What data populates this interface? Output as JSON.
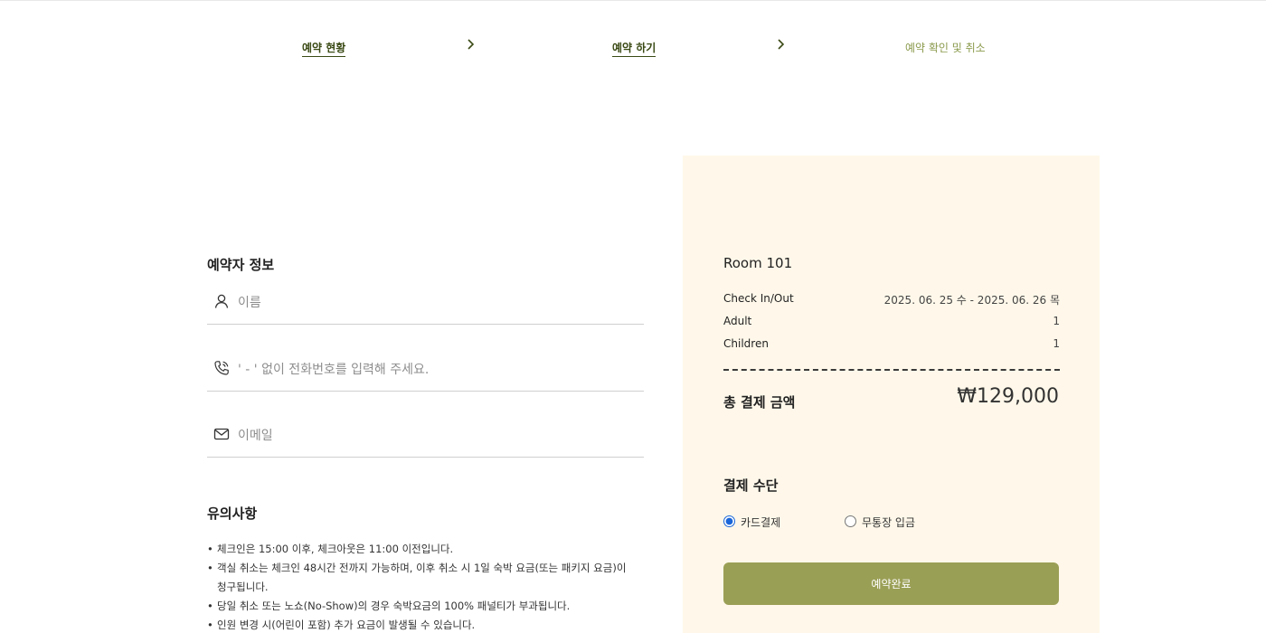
{
  "steps": [
    {
      "label": "예약 현황",
      "state": "done"
    },
    {
      "label": "예약 하기",
      "state": "current"
    },
    {
      "label": "예약 확인 및 취소",
      "state": "pending"
    }
  ],
  "guest": {
    "title": "예약자 정보",
    "name_placeholder": "이름",
    "phone_placeholder": "' - ' 없이 전화번호를 입력해 주세요.",
    "email_placeholder": "이메일"
  },
  "notes": {
    "title": "유의사항",
    "items": [
      "체크인은 15:00 이후, 체크아웃은 11:00 이전입니다.",
      "객실 취소는 체크인 48시간 전까지 가능하며, 이후 취소 시 1일 숙박 요금(또는 패키지 요금)이 청구됩니다.",
      "당일 취소 또는 노쇼(No-Show)의 경우 숙박요금의 100% 패널티가 부과됩니다.",
      "인원 변경 시(어린이 포함) 추가 요금이 발생될 수 있습니다."
    ]
  },
  "summary": {
    "room": "Room 101",
    "rows": [
      {
        "key": "Check In/Out",
        "value": "2025. 06. 25 수 - 2025. 06. 26 목"
      },
      {
        "key": "Adult",
        "value": "1"
      },
      {
        "key": "Children",
        "value": "1"
      }
    ],
    "total_label": "총 결제 금액",
    "total_amount": "₩129,000"
  },
  "payment": {
    "title": "결제 수단",
    "options": [
      {
        "label": "카드결제",
        "selected": true
      },
      {
        "label": "무통장 입금",
        "selected": false
      }
    ],
    "submit_label": "예약완료"
  },
  "colors": {
    "accent": "#9a9f56",
    "step_active": "#3a4a14",
    "step_pending": "#8a9a4c",
    "panel_bg": "#fff8ea"
  },
  "icons": [
    "chevron-right-icon",
    "user-icon",
    "phone-icon",
    "mail-icon"
  ]
}
